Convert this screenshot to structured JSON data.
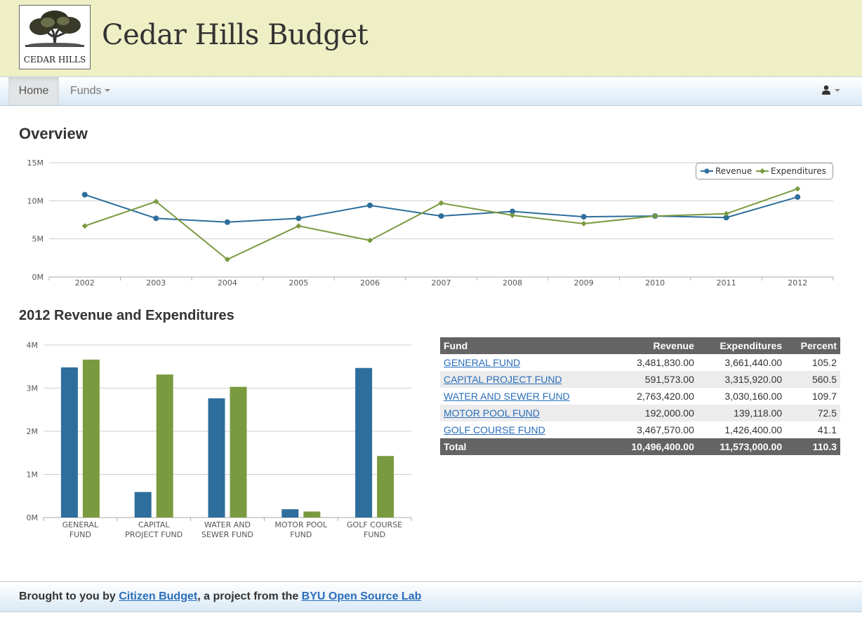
{
  "header": {
    "title": "Cedar Hills Budget",
    "logo_text": "CEDAR HILLS"
  },
  "nav": {
    "home_label": "Home",
    "funds_label": "Funds",
    "user_icon": "user-icon"
  },
  "overview": {
    "title": "Overview"
  },
  "section2": {
    "title": "2012 Revenue and Expenditures"
  },
  "colors": {
    "revenue": "#2d6e9c",
    "expenditures": "#7a9a40",
    "header_bg": "#efefc6",
    "table_header_bg": "#646464",
    "link": "#2a6ebb"
  },
  "chart_data": [
    {
      "type": "line",
      "x": [
        "2002",
        "2003",
        "2004",
        "2005",
        "2006",
        "2007",
        "2008",
        "2009",
        "2010",
        "2011",
        "2012"
      ],
      "y_ticks": [
        "0M",
        "5M",
        "10M",
        "15M"
      ],
      "ylim": [
        0,
        15000000
      ],
      "series": [
        {
          "name": "Revenue",
          "values": [
            10800000,
            7700000,
            7200000,
            7700000,
            9400000,
            8000000,
            8600000,
            7900000,
            8000000,
            7800000,
            10496400
          ]
        },
        {
          "name": "Expenditures",
          "values": [
            6700000,
            9900000,
            2300000,
            6700000,
            4800000,
            9700000,
            8100000,
            7000000,
            8000000,
            8300000,
            11573000
          ]
        }
      ],
      "legend_position": "top-right",
      "grid": true
    },
    {
      "type": "bar",
      "categories": [
        [
          "GENERAL",
          "FUND"
        ],
        [
          "CAPITAL",
          "PROJECT FUND"
        ],
        [
          "WATER AND",
          "SEWER FUND"
        ],
        [
          "MOTOR POOL",
          "FUND"
        ],
        [
          "GOLF COURSE",
          "FUND"
        ]
      ],
      "y_ticks": [
        "0M",
        "1M",
        "2M",
        "3M",
        "4M"
      ],
      "ylim": [
        0,
        4000000
      ],
      "series": [
        {
          "name": "Revenue",
          "values": [
            3481830,
            591573,
            2763420,
            192000,
            3467570
          ]
        },
        {
          "name": "Expenditures",
          "values": [
            3661440,
            3315920,
            3030160,
            139118,
            1426400
          ]
        }
      ],
      "grid": true
    }
  ],
  "table": {
    "headers": [
      "Fund",
      "Revenue",
      "Expenditures",
      "Percent"
    ],
    "rows": [
      {
        "fund": "GENERAL FUND",
        "revenue": "3,481,830.00",
        "expenditures": "3,661,440.00",
        "percent": "105.2"
      },
      {
        "fund": "CAPITAL PROJECT FUND",
        "revenue": "591,573.00",
        "expenditures": "3,315,920.00",
        "percent": "560.5"
      },
      {
        "fund": "WATER AND SEWER FUND",
        "revenue": "2,763,420.00",
        "expenditures": "3,030,160.00",
        "percent": "109.7"
      },
      {
        "fund": "MOTOR POOL FUND",
        "revenue": "192,000.00",
        "expenditures": "139,118.00",
        "percent": "72.5"
      },
      {
        "fund": "GOLF COURSE FUND",
        "revenue": "3,467,570.00",
        "expenditures": "1,426,400.00",
        "percent": "41.1"
      }
    ],
    "total": {
      "label": "Total",
      "revenue": "10,496,400.00",
      "expenditures": "11,573,000.00",
      "percent": "110.3"
    }
  },
  "footer": {
    "prefix": "Brought to you by ",
    "link1": "Citizen Budget",
    "middle": ", a project from the ",
    "link2": "BYU Open Source Lab"
  }
}
